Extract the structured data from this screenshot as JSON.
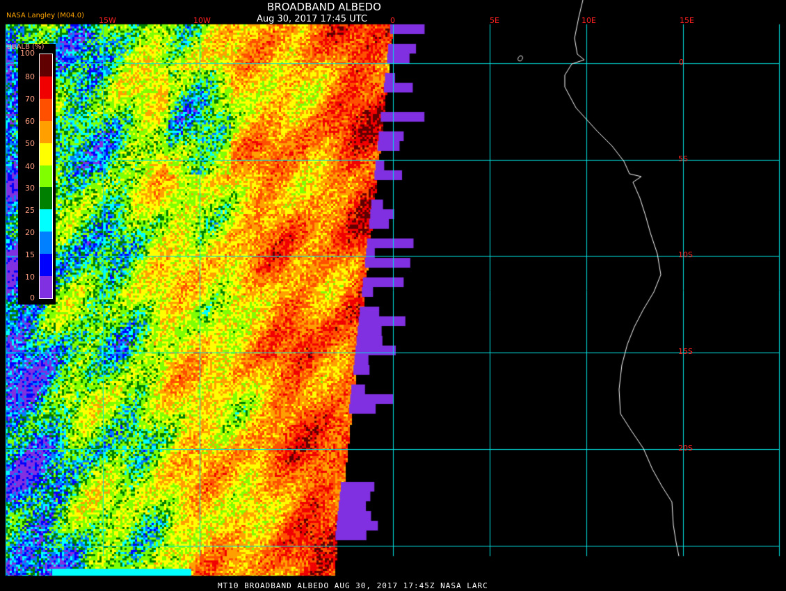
{
  "header": {
    "title": "BROADBAND ALBEDO",
    "subtitle": "Aug 30, 2017 17:45 UTC",
    "source": "NASA Langley (M04.0)"
  },
  "grid": {
    "longitude_labels": [
      "15W",
      "10W",
      "0",
      "5E",
      "10E",
      "15E"
    ],
    "latitude_labels": [
      "0",
      "5S",
      "10S",
      "15S",
      "20S"
    ]
  },
  "legend": {
    "title": "BBALB (%)",
    "ticks": [
      "100",
      "80",
      "70",
      "60",
      "50",
      "40",
      "30",
      "25",
      "20",
      "15",
      "10",
      "0"
    ],
    "colors": [
      "#600000",
      "#600000",
      "#f00000",
      "#ff5000",
      "#ffa000",
      "#ffff00",
      "#80ff00",
      "#008000",
      "#00ffff",
      "#0080ff",
      "#0000ff",
      "#8030e0"
    ]
  },
  "footer": "MT10  BROADBAND ALBEDO   AUG 30, 2017 17:45Z   NASA LARC",
  "colors": {
    "grid": "#00e0e0",
    "coast": "#ffffff",
    "no_data_ocean": "#8030e0",
    "label": "#ff2020"
  }
}
